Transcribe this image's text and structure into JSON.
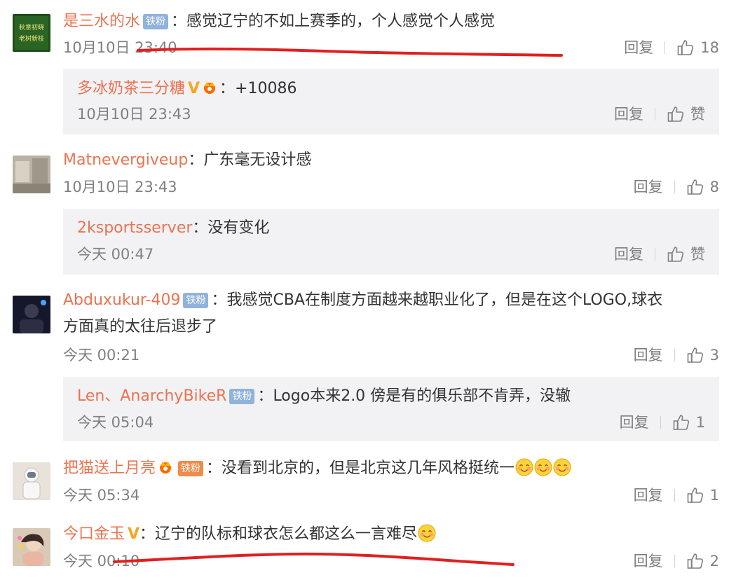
{
  "comments": [
    {
      "user": "是三水的水",
      "badge": "铁粉",
      "text": "：感觉辽宁的不如上赛季的，个人感觉个人感觉",
      "time": "10月10日 23:40",
      "reply_label": "回复",
      "likes": "18",
      "reply": {
        "user": "多冰奶茶三分糖",
        "vmark": "V",
        "text": "：+10086",
        "time": "10月10日 23:43",
        "reply_label": "回复",
        "likes": "赞"
      }
    },
    {
      "user": "Matnevergiveup",
      "text": "：广东毫无设计感",
      "time": "10月10日 23:43",
      "reply_label": "回复",
      "likes": "8",
      "reply": {
        "user": "2ksportsserver",
        "text": "：没有变化",
        "time": "今天 00:47",
        "reply_label": "回复",
        "likes": "赞"
      }
    },
    {
      "user": "Abduxukur-409",
      "badge": "铁粉",
      "text": "：我感觉CBA在制度方面越来越职业化了，但是在这个LOGO,球衣",
      "text2": "方面真的太往后退步了",
      "time": "今天 00:21",
      "reply_label": "回复",
      "likes": "3",
      "reply": {
        "user": "Len、AnarchyBikeR",
        "badge": "铁粉",
        "text": "：Logo本来2.0 傍是有的俱乐部不肯弄，没辙",
        "time": "今天 05:04",
        "reply_label": "回复",
        "likes": "1"
      }
    },
    {
      "user": "把猫送上月亮",
      "badge": "铁粉",
      "text": "：没看到北京的，但是北京这几年风格挺统一",
      "time": "今天 05:34",
      "reply_label": "回复",
      "likes": "1"
    },
    {
      "user": "今口金玉",
      "vmark": "V",
      "text": "：辽宁的队标和球衣怎么都这么一言难尽",
      "time": "今天 00:10",
      "reply_label": "回复",
      "likes": "2"
    }
  ],
  "colors": {
    "username": "#eb7350",
    "badge": "#8fb3db",
    "reply_bg": "#f2f2f5",
    "meta": "#808080",
    "annotation": "#e02020"
  },
  "icons": {
    "like": "thumbs-up-icon",
    "emoji": "smiling-face-emoji"
  }
}
